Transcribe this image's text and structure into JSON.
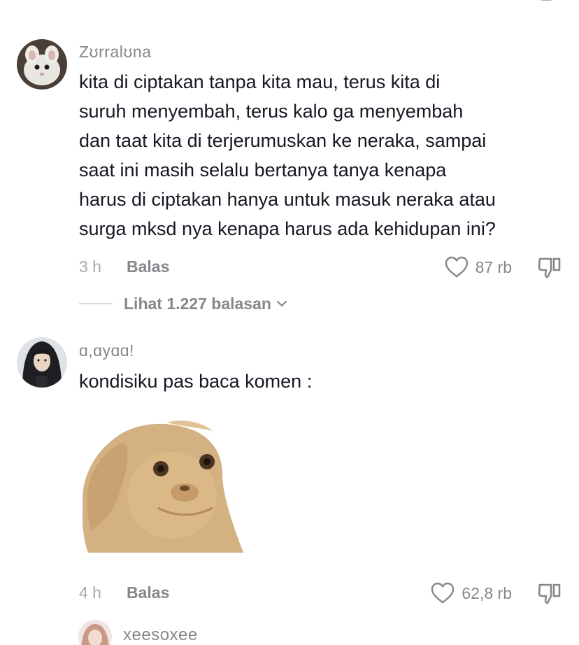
{
  "comments": [
    {
      "username": "Zʊrralʊna",
      "text": "kita di ciptakan tanpa kita mau, terus kita di suruh menyembah, terus kalo ga menyembah dan taat kita di terjerumuskan ke neraka, sampai saat ini masih selalu bertanya tanya kenapa harus di ciptakan hanya untuk masuk neraka atau surga mksd nya kenapa harus ada kehidupan ini?",
      "lines": [
        "kita di ciptakan tanpa kita mau, terus kita di",
        "suruh menyembah, terus kalo ga menyembah",
        "dan taat kita di terjerumuskan ke neraka, sampai",
        "saat ini masih selalu bertanya tanya kenapa",
        "harus di ciptakan hanya untuk masuk neraka atau",
        "surga mksd nya kenapa harus ada kehidupan ini?"
      ],
      "time": "3 h",
      "reply_label": "Balas",
      "likes": "87 rb",
      "view_replies": "Lihat 1.227 balasan"
    },
    {
      "username": "ɑ,ɑyɑɑ!",
      "text": "kondisiku pas baca komen :",
      "time": "4 h",
      "reply_label": "Balas",
      "likes": "62,8 rb"
    },
    {
      "username": "xeesoxee"
    }
  ],
  "icons": {
    "like": "heart-outline-icon",
    "dislike": "thumbs-down-icon",
    "chevron": "chevron-down-icon"
  },
  "colors": {
    "text": "#161823",
    "secondary": "#86878b",
    "muted": "#a7a8ab"
  }
}
